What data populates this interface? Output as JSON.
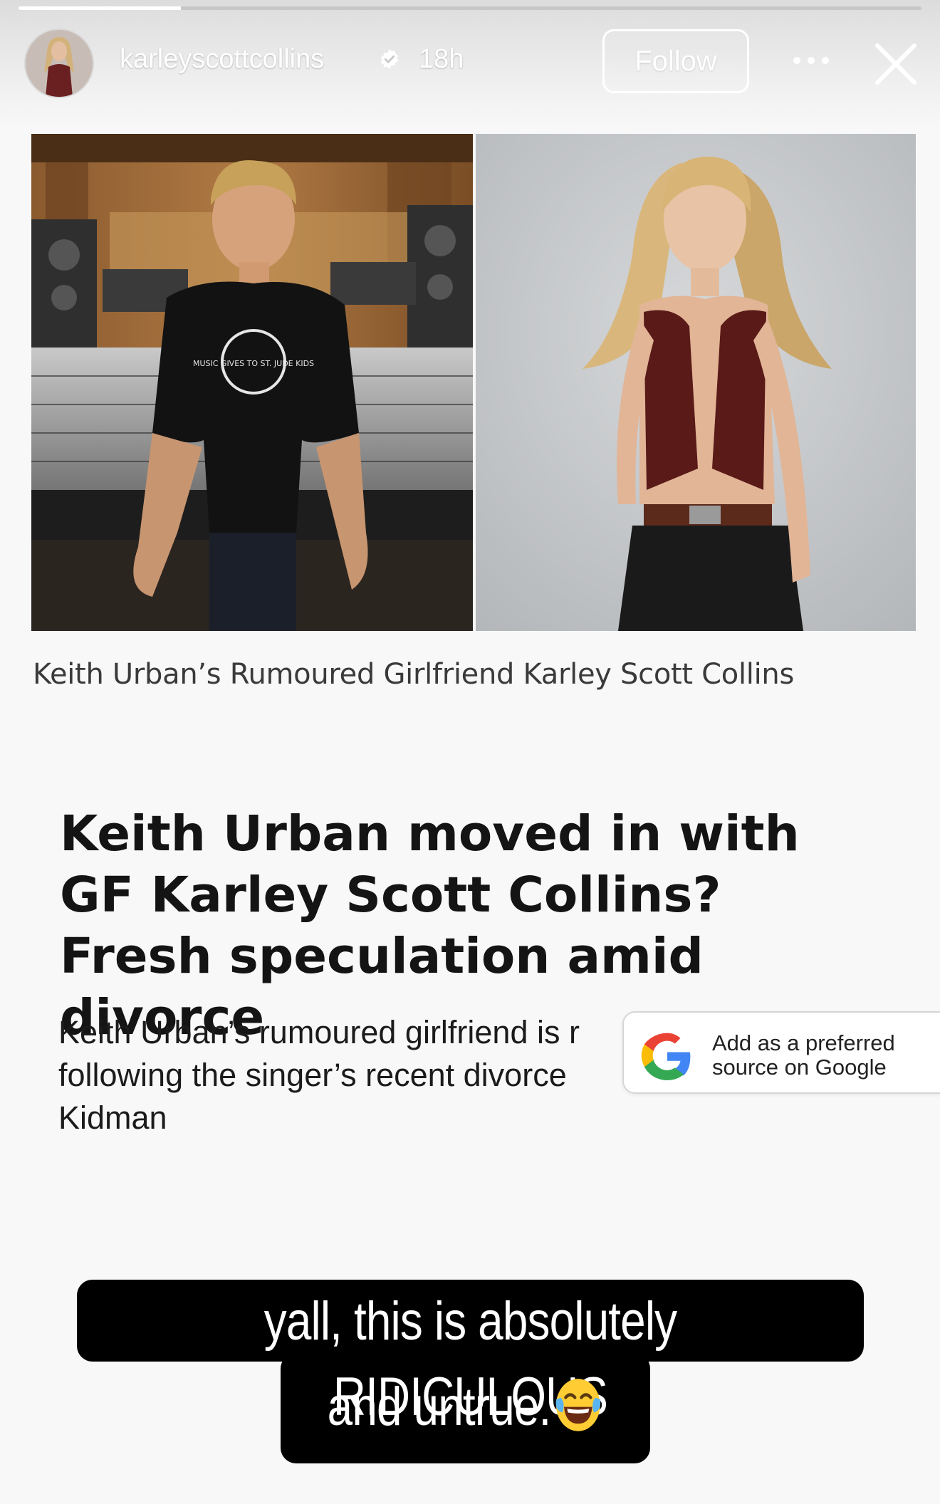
{
  "story": {
    "progress": 0.18,
    "username": "karleyscottcollins",
    "verified": true,
    "time_ago": "18h",
    "follow_label": "Follow",
    "more_icon": "more-horizontal-icon",
    "close_icon": "close-icon"
  },
  "article": {
    "caption": "Keith Urban’s Rumoured Girlfriend Karley Scott Collins",
    "headline": "Keith Urban moved in with GF Karley Scott Collins? Fresh speculation amid divorce",
    "excerpt": "Keith Urban’s rumoured girlfriend is r following the singer’s recent divorce Kidman",
    "tshirt_text": "MUSIC GIVES TO ST. JUDE KIDS",
    "google_prompt": "Add as a preferred source on Google"
  },
  "sticker": {
    "line1": "yall, this is absolutely RIDICULOUS",
    "line2": "and untrue.",
    "emoji": "😂"
  },
  "colors": {
    "sticker_bg": "#000000",
    "headline": "#141414",
    "google_blue": "#4285F4",
    "google_red": "#EA4335",
    "google_yellow": "#FBBC05",
    "google_green": "#34A853"
  }
}
